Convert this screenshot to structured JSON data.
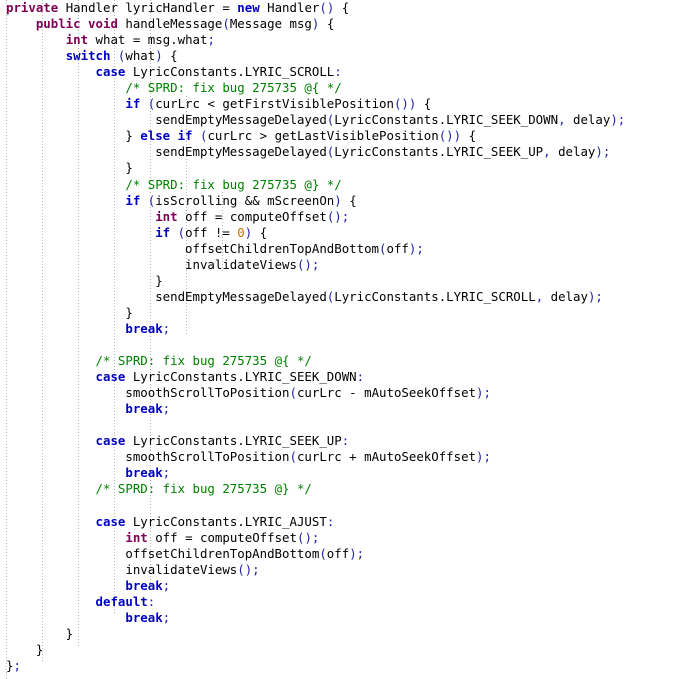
{
  "editor": {
    "language": "java",
    "background": "#ffffff",
    "font_size_px": 12.4,
    "line_height_px": 16.05,
    "indent_guide_color": "#b4b4b4",
    "colors": {
      "text": "#000000",
      "modifier_keyword": "#7f0055",
      "control_keyword": "#0000c0",
      "comment": "#008000",
      "number": "#d07000",
      "punctuation": "#2222aa"
    },
    "indent_guide_x": [
      6,
      42,
      78,
      114,
      150,
      186,
      222,
      258
    ]
  },
  "code": {
    "lines": [
      "private Handler lyricHandler = new Handler() {",
      "    public void handleMessage(Message msg) {",
      "        int what = msg.what;",
      "        switch (what) {",
      "            case LyricConstants.LYRIC_SCROLL:",
      "                /* SPRD: fix bug 275735 @{ */",
      "                if (curLrc < getFirstVisiblePosition()) {",
      "                    sendEmptyMessageDelayed(LyricConstants.LYRIC_SEEK_DOWN, delay);",
      "                } else if (curLrc > getLastVisiblePosition()) {",
      "                    sendEmptyMessageDelayed(LyricConstants.LYRIC_SEEK_UP, delay);",
      "                }",
      "                /* SPRD: fix bug 275735 @} */",
      "                if (isScrolling && mScreenOn) {",
      "                    int off = computeOffset();",
      "                    if (off != 0) {",
      "                        offsetChildrenTopAndBottom(off);",
      "                        invalidateViews();",
      "                    }",
      "                    sendEmptyMessageDelayed(LyricConstants.LYRIC_SCROLL, delay);",
      "                }",
      "                break;",
      "",
      "            /* SPRD: fix bug 275735 @{ */",
      "            case LyricConstants.LYRIC_SEEK_DOWN:",
      "                smoothScrollToPosition(curLrc - mAutoSeekOffset);",
      "                break;",
      "",
      "            case LyricConstants.LYRIC_SEEK_UP:",
      "                smoothScrollToPosition(curLrc + mAutoSeekOffset);",
      "                break;",
      "            /* SPRD: fix bug 275735 @} */",
      "",
      "            case LyricConstants.LYRIC_AJUST:",
      "                int off = computeOffset();",
      "                offsetChildrenTopAndBottom(off);",
      "                invalidateViews();",
      "                break;",
      "            default:",
      "                break;",
      "        }",
      "    }",
      "};"
    ],
    "tokens": {
      "modifier_keywords": [
        "private",
        "public",
        "void",
        "int"
      ],
      "control_keywords": [
        "new",
        "switch",
        "case",
        "break",
        "if",
        "else",
        "default"
      ],
      "comments": [
        "/* SPRD: fix bug 275735 @{ */",
        "/* SPRD: fix bug 275735 @} */"
      ],
      "numbers": [
        "0"
      ],
      "identifiers": [
        "Handler",
        "lyricHandler",
        "handleMessage",
        "Message",
        "msg",
        "what",
        "LyricConstants",
        "LYRIC_SCROLL",
        "LYRIC_SEEK_DOWN",
        "LYRIC_SEEK_UP",
        "LYRIC_AJUST",
        "curLrc",
        "getFirstVisiblePosition",
        "getLastVisiblePosition",
        "sendEmptyMessageDelayed",
        "delay",
        "isScrolling",
        "mScreenOn",
        "off",
        "computeOffset",
        "offsetChildrenTopAndBottom",
        "invalidateViews",
        "smoothScrollToPosition",
        "mAutoSeekOffset"
      ]
    }
  }
}
